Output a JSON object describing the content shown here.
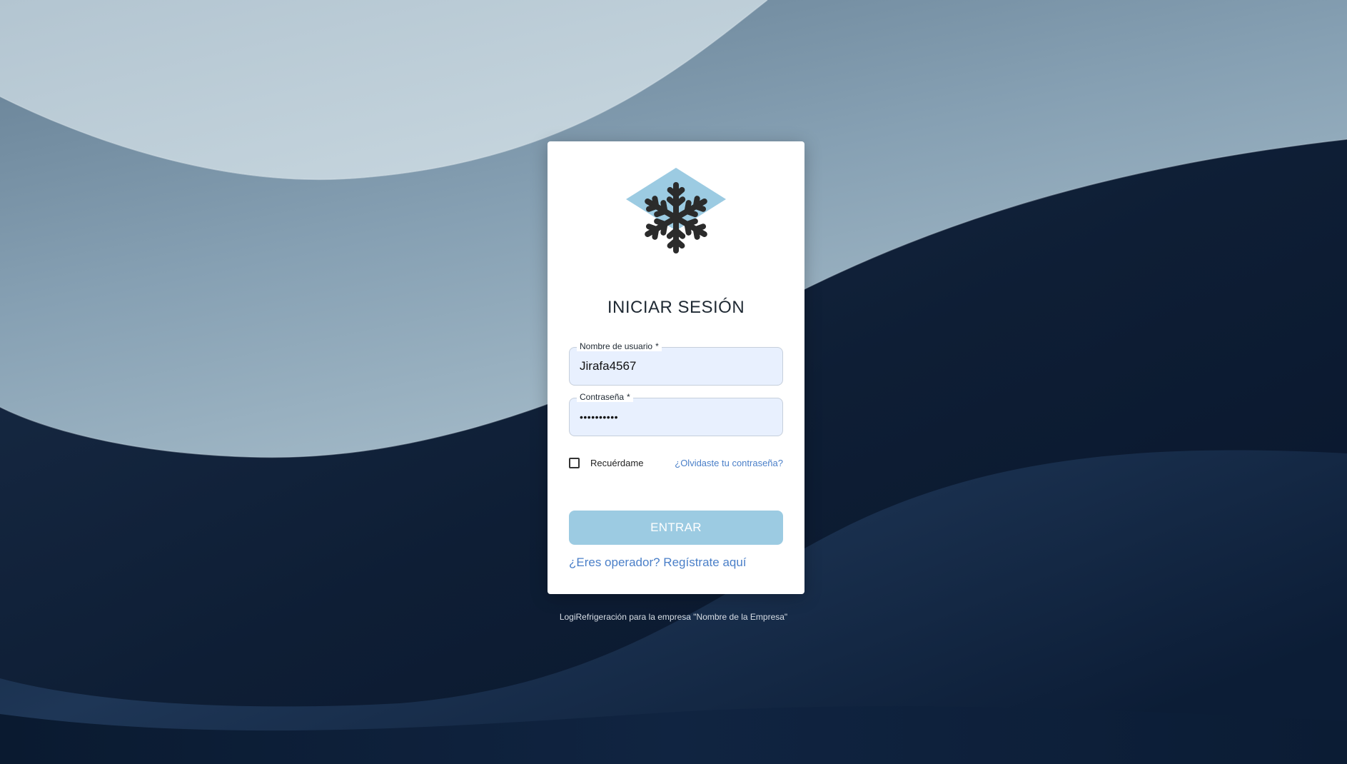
{
  "login": {
    "title": "INICIAR SESIÓN",
    "username": {
      "label": "Nombre de usuario",
      "required_mark": "*",
      "value": "Jirafa4567"
    },
    "password": {
      "label": "Contraseña",
      "required_mark": "*",
      "value": "••••••••••"
    },
    "remember": {
      "label": "Recuérdame",
      "checked": false
    },
    "forgot_link": "¿Olvidaste tu contraseña?",
    "submit_label": "ENTRAR",
    "register_link": "¿Eres operador? Regístrate aquí"
  },
  "footer": {
    "text": "LogiRefrigeración para la empresa \"Nombre de la Empresa\""
  },
  "logo": {
    "icon": "snowflake-icon",
    "diamond_color": "#9ccbe2",
    "snowflake_color": "#2b2b2b"
  },
  "colors": {
    "accent": "#4a7fc8",
    "button": "#9ccbe2",
    "input_background": "#e8f0fe"
  }
}
